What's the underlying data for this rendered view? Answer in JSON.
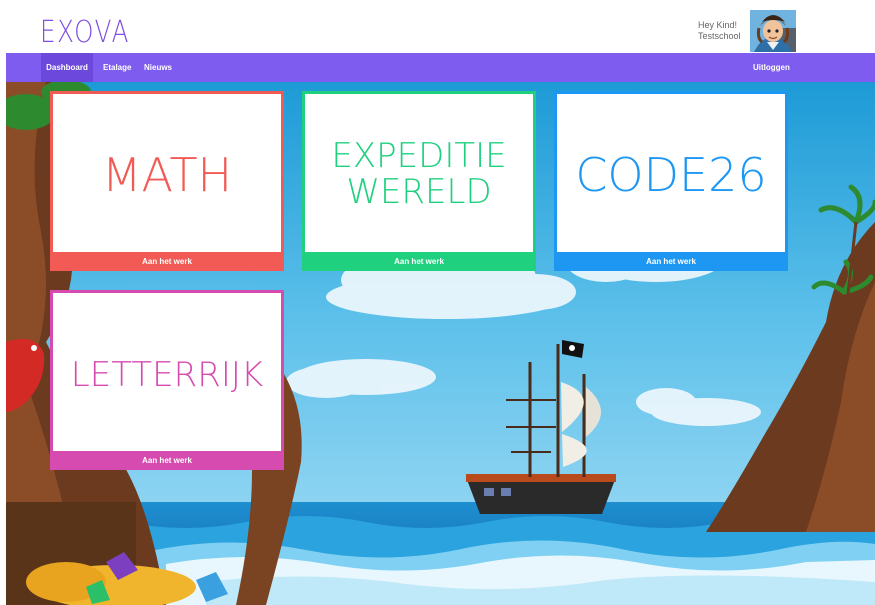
{
  "header": {
    "logo": "EXOVA",
    "greeting": "Hey Kind!",
    "school": "Testschool"
  },
  "nav": {
    "items": [
      {
        "label": "Dashboard"
      },
      {
        "label": "Etalage"
      },
      {
        "label": "Nieuws"
      }
    ],
    "logout": "Uitloggen"
  },
  "cards": [
    {
      "title": "MATH",
      "action": "Aan het werk",
      "color": "#f25a55"
    },
    {
      "title_line1": "EXPEDITIE",
      "title_line2": "WERELD",
      "action": "Aan het werk",
      "color": "#1fd07f"
    },
    {
      "title": "CODE26",
      "action": "Aan het werk",
      "color": "#1e97f3"
    },
    {
      "title": "LETTERRIJK",
      "action": "Aan het werk",
      "color": "#d64bb0"
    }
  ],
  "colors": {
    "brand": "#7d4fe0",
    "nav": "#7e5cf0"
  }
}
